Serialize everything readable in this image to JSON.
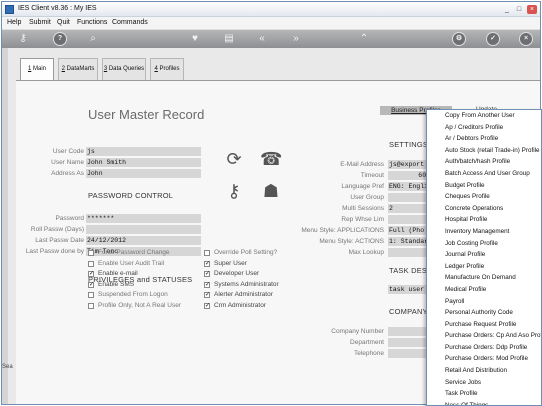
{
  "window": {
    "title": "IES Client v8.36 : My IES"
  },
  "menu": [
    "Help",
    "Submit",
    "Quit",
    "Functions",
    "Commands"
  ],
  "toolbar": [
    "key-icon",
    "help-icon",
    "search-icon",
    "heart-icon",
    "print-icon",
    "back-icon",
    "forward-icon",
    "up-icon",
    "settings-icon",
    "confirm-icon",
    "close-icon"
  ],
  "tabs": [
    {
      "num": "1",
      "label": "Main"
    },
    {
      "num": "2",
      "label": "DataMarts"
    },
    {
      "num": "3",
      "label": "Data Queries"
    },
    {
      "num": "4",
      "label": "Profiles"
    }
  ],
  "page": {
    "title": "User Master Record"
  },
  "user": {
    "code_label": "User Code",
    "code": "js",
    "name_label": "User Name",
    "name": "John Smith",
    "address_label": "Address As",
    "address": "John"
  },
  "password": {
    "heading": "PASSWORD CONTROL",
    "pw_label": "Password",
    "pw": "*******",
    "roll_label": "Roll Passw (Days)",
    "roll": "",
    "last_date_label": "Last Passw Date",
    "last_date": "24/12/2012",
    "last_by_label": "Last Passw done by",
    "last_by": "Tim Tono"
  },
  "privileges": {
    "heading": "PRIVILEGES and STATUSES",
    "left": [
      {
        "label": "Force Password Change",
        "checked": false
      },
      {
        "label": "Enable User Audit Trail",
        "checked": false
      },
      {
        "label": "Enable e-mail",
        "checked": true
      },
      {
        "label": "Enable SMS",
        "checked": true
      },
      {
        "label": "Suspended From Logon",
        "checked": false
      },
      {
        "label": "Profile Only, Not A Real User",
        "checked": false
      }
    ],
    "right": [
      {
        "label": "Override Poll Setting?",
        "checked": false
      },
      {
        "label": "Super User",
        "checked": true
      },
      {
        "label": "Developer User",
        "checked": true
      },
      {
        "label": "Systems Administrator",
        "checked": true
      },
      {
        "label": "Alerter Administrator",
        "checked": true
      },
      {
        "label": "Crm Administrator",
        "checked": true
      }
    ]
  },
  "settings": {
    "heading": "SETTINGS",
    "email_label": "E-Mail Address",
    "email": "js@export",
    "timeout_label": "Timeout",
    "timeout": "600",
    "lang_label": "Language Pref",
    "lang": "ENG: Engli",
    "group_label": "User Group",
    "group": "",
    "multi_label": "Multi Sessions",
    "multi": "2",
    "whse_label": "Rep Whse Lim",
    "whse": "",
    "menu_apps_label": "Menu Style: APPLICATIONS",
    "menu_apps": "Full (Pho",
    "menu_actions_label": "Menu Style: ACTIONS",
    "menu_actions": "1: Standar",
    "maxlookup_label": "Max Lookup",
    "maxlookup": ""
  },
  "task": {
    "heading": "TASK DESK",
    "value": "task user"
  },
  "company": {
    "heading": "COMPANY IN",
    "number_label": "Company Number",
    "dept_label": "Department",
    "phone_label": "Telephone"
  },
  "buttons": {
    "business_profiles": "Business Profiles",
    "update": "Update"
  },
  "left_stub": "Sea",
  "dropdown": [
    "Copy From Another User",
    "Ap / Creditors Profile",
    "Ar / Debtors Profile",
    "Auto Stock (retail Trade-in) Profile",
    "Auth/batch/hash Profile",
    "Batch Access And User Group",
    "Budget Profile",
    "Cheques Profile",
    "Concrete Operations",
    "Hospital Profile",
    "Inventory Management",
    "Job Costing Profile",
    "Journal Profile",
    "Ledger Profile",
    "Manufacture On Demand",
    "Medical Profile",
    "Payroll",
    "Personal Authority Code",
    "Purchase Request Profile",
    "Purchase Orders: Cp And Aso Profile",
    "Purchase Orders: Ddp Profile",
    "Purchase Orders: Mod Profile",
    "Retail And Distribution",
    "Service Jobs",
    "Task Profile",
    "Ness Of Things"
  ]
}
